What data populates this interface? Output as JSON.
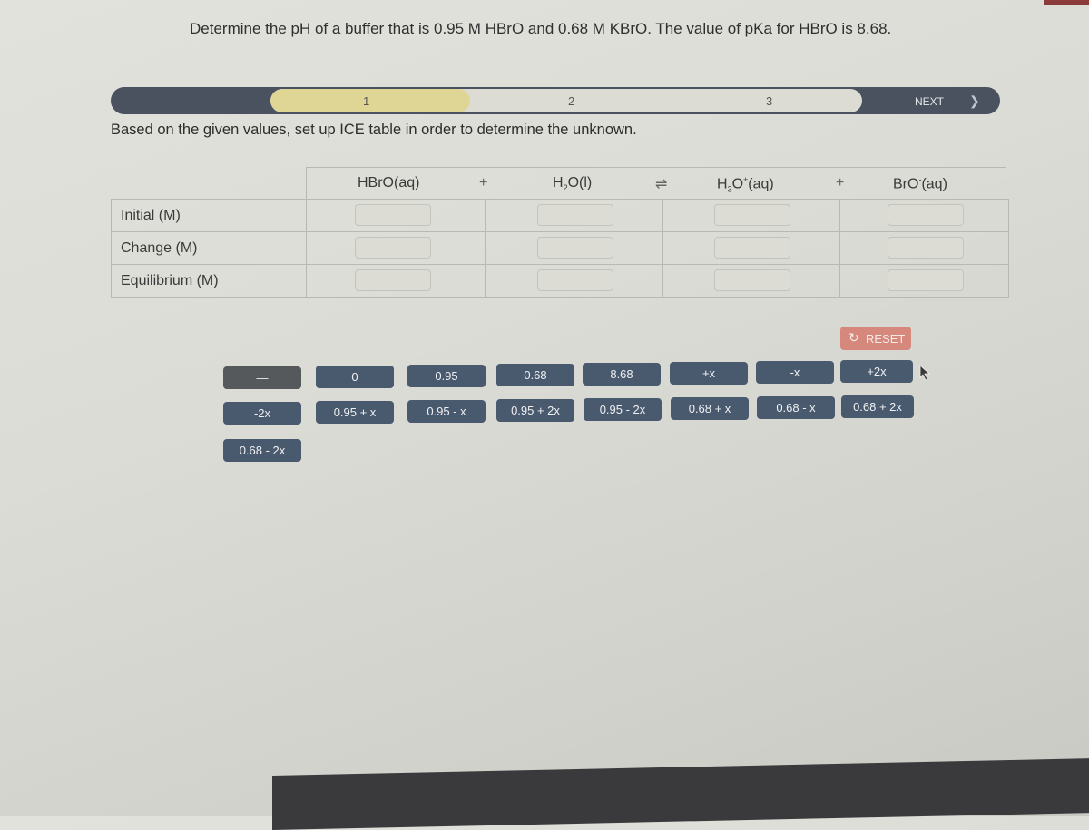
{
  "question": {
    "text": "Determine the pH of a buffer that is 0.95 M HBrO and 0.68 M KBrO. The value of pKa for HBrO is 8.68."
  },
  "stepper": {
    "steps": [
      "1",
      "2",
      "3"
    ],
    "active_step": 1,
    "next_label": "NEXT",
    "next_icon": "chevron-right-icon"
  },
  "instruction": "Based on the given values, set up ICE table in order to determine the unknown.",
  "ice_table": {
    "species": [
      {
        "main": "HBrO(aq)",
        "pre": "",
        "sub": "",
        "mid": "",
        "sup": "",
        "post": ""
      },
      {
        "pre": "H",
        "sub": "2",
        "mid": "O(l)",
        "sup": "",
        "post": ""
      },
      {
        "pre": "H",
        "sub": "3",
        "mid": "O",
        "sup": "+",
        "post": "(aq)"
      },
      {
        "pre": "BrO",
        "sub": "",
        "mid": "",
        "sup": "-",
        "post": "(aq)"
      }
    ],
    "operators": [
      "+",
      "⇌",
      "+"
    ],
    "rows": [
      {
        "label": "Initial (M)",
        "cells": [
          "",
          "",
          "",
          ""
        ]
      },
      {
        "label": "Change (M)",
        "cells": [
          "",
          "",
          "",
          ""
        ]
      },
      {
        "label": "Equilibrium (M)",
        "cells": [
          "",
          "",
          "",
          ""
        ]
      }
    ]
  },
  "reset": {
    "label": "RESET",
    "icon": "undo-icon"
  },
  "tiles": [
    "—",
    "0",
    "0.95",
    "0.68",
    "8.68",
    "+x",
    "-x",
    "+2x",
    "-2x",
    "0.95 + x",
    "0.95 - x",
    "0.95 + 2x",
    "0.95 - 2x",
    "0.68 + x",
    "0.68 - x",
    "0.68 + 2x",
    "0.68 - 2x"
  ],
  "colors": {
    "stepper_bg": "#4a5260",
    "active_step": "#dfd594",
    "tile_bg": "#4a5a6e",
    "reset_bg": "#d6887c"
  }
}
